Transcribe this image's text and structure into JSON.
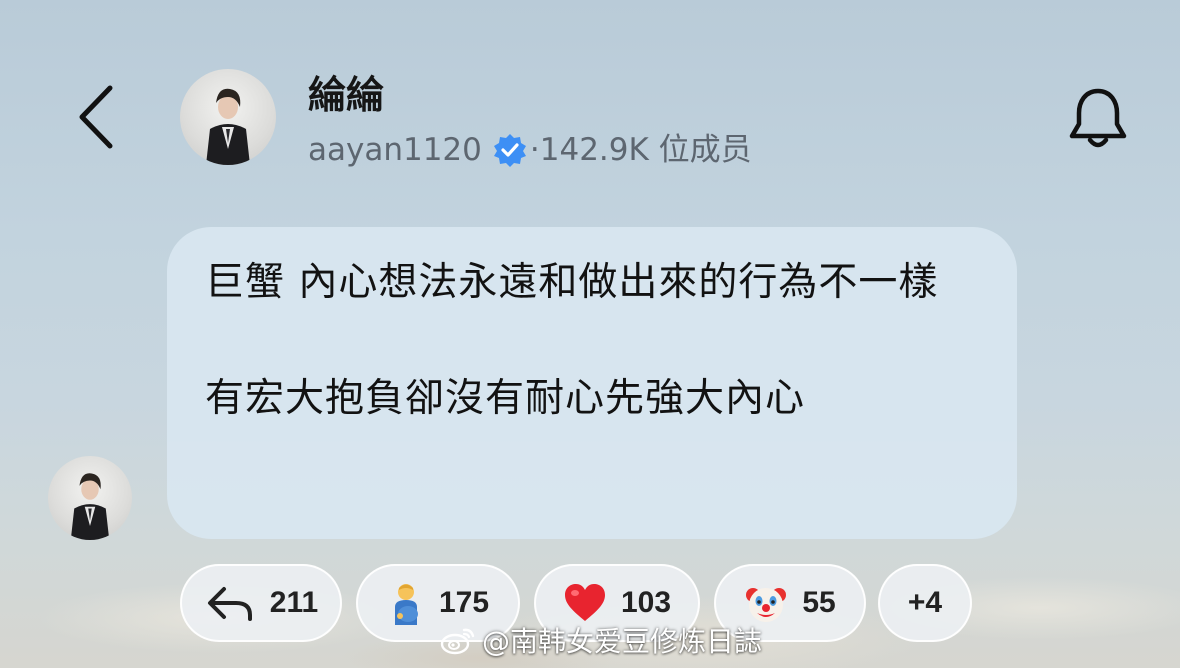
{
  "header": {
    "back_icon": "chevron-left-icon",
    "channel_name": "綸綸",
    "username": "aayan1120",
    "verified_icon": "verified-badge-icon",
    "separator": "·",
    "members": "142.9K 位成员",
    "bell_icon": "bell-icon"
  },
  "message": {
    "line1": "巨蟹 內心想法永遠和做出來的行為不一樣",
    "line2": "有宏大抱負卻沒有耐心先強大內心"
  },
  "reactions": [
    {
      "icon": "reply-icon",
      "count": "211"
    },
    {
      "icon": "pregnant-man-emoji",
      "count": "175"
    },
    {
      "icon": "red-heart-emoji",
      "count": "103"
    },
    {
      "icon": "clown-face-emoji",
      "count": "55"
    },
    {
      "icon": "more-reactions",
      "count": "+4"
    }
  ],
  "watermark": {
    "icon": "weibo-logo",
    "text": "@南韩女爱豆修炼日誌"
  },
  "colors": {
    "bubble": "#d8e6f0",
    "verified": "#3d8ff5",
    "heart": "#e8242f"
  }
}
